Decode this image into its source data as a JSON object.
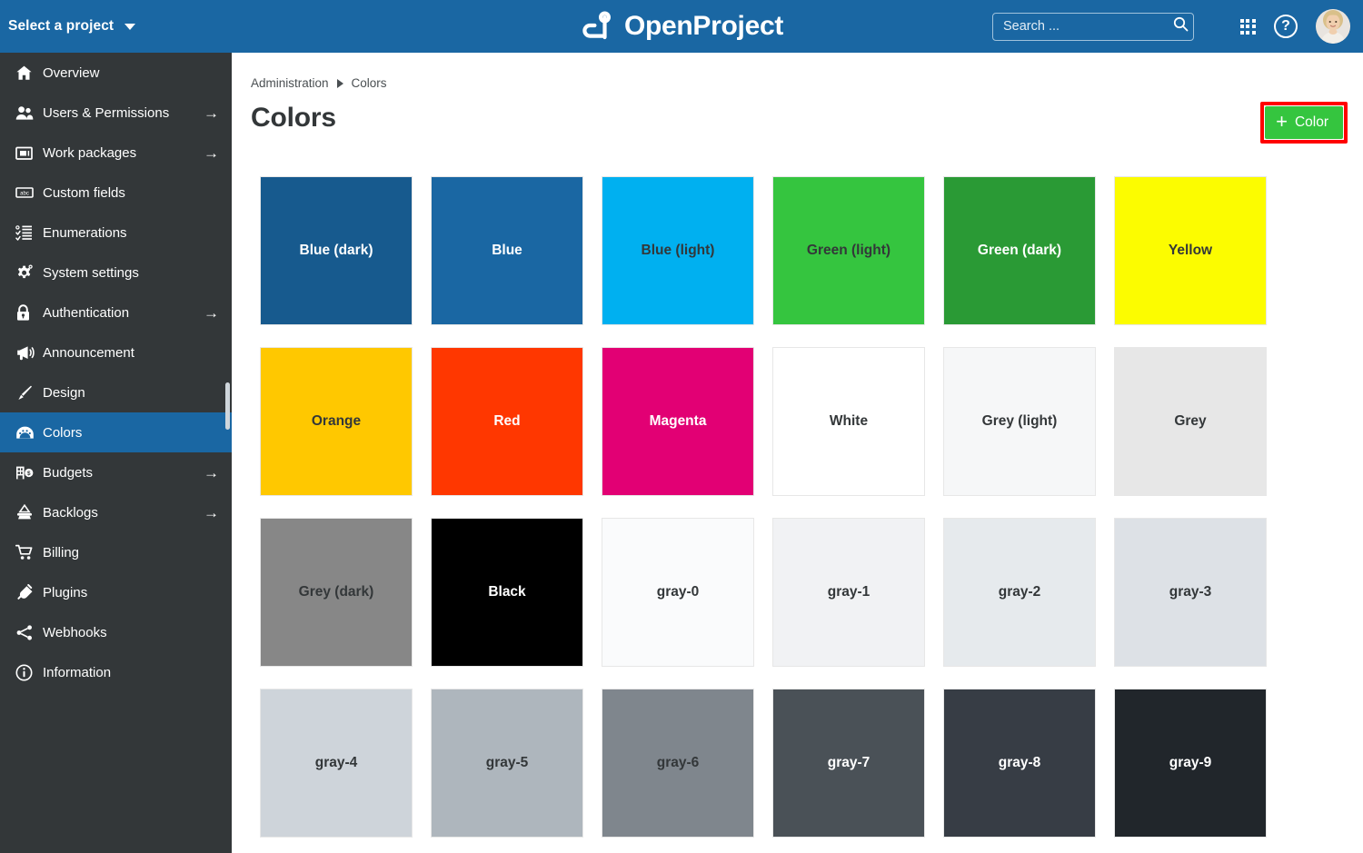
{
  "header": {
    "project_select_label": "Select a project",
    "logo_text": "OpenProject",
    "search_placeholder": "Search ...",
    "search_value": "",
    "brand_blue": "#1a67a3"
  },
  "sidebar": {
    "background": "#333739",
    "active_background": "#1a67a3",
    "items": [
      {
        "label": "Overview",
        "icon": "home-icon",
        "arrow": "",
        "active": false
      },
      {
        "label": "Users & Permissions",
        "icon": "users-icon",
        "arrow": "→",
        "active": false
      },
      {
        "label": "Work packages",
        "icon": "work-package-icon",
        "arrow": "→",
        "active": false
      },
      {
        "label": "Custom fields",
        "icon": "custom-field-icon",
        "arrow": "",
        "active": false
      },
      {
        "label": "Enumerations",
        "icon": "list-icon",
        "arrow": "",
        "active": false
      },
      {
        "label": "System settings",
        "icon": "gear-icon",
        "arrow": "",
        "active": false
      },
      {
        "label": "Authentication",
        "icon": "lock-icon",
        "arrow": "→",
        "active": false
      },
      {
        "label": "Announcement",
        "icon": "megaphone-icon",
        "arrow": "",
        "active": false
      },
      {
        "label": "Design",
        "icon": "brush-icon",
        "arrow": "",
        "active": false
      },
      {
        "label": "Colors",
        "icon": "palette-icon",
        "arrow": "",
        "active": true
      },
      {
        "label": "Budgets",
        "icon": "budget-icon",
        "arrow": "→",
        "active": false
      },
      {
        "label": "Backlogs",
        "icon": "backlogs-icon",
        "arrow": "→",
        "active": false
      },
      {
        "label": "Billing",
        "icon": "cart-icon",
        "arrow": "",
        "active": false
      },
      {
        "label": "Plugins",
        "icon": "plug-icon",
        "arrow": "",
        "active": false
      },
      {
        "label": "Webhooks",
        "icon": "webhook-icon",
        "arrow": "",
        "active": false
      },
      {
        "label": "Information",
        "icon": "info-icon",
        "arrow": "",
        "active": false
      }
    ]
  },
  "breadcrumb": {
    "parent": "Administration",
    "current": "Colors"
  },
  "page": {
    "title": "Colors"
  },
  "toolbar": {
    "add_color_label": "Color",
    "add_color_plus": "+",
    "add_color_background": "#35c53f",
    "highlight_color": "#ff0000"
  },
  "colors": [
    {
      "name": "Blue (dark)",
      "hex": "#175a8e",
      "text": "#ffffff"
    },
    {
      "name": "Blue",
      "hex": "#1a67a3",
      "text": "#ffffff"
    },
    {
      "name": "Blue (light)",
      "hex": "#00b0f0",
      "text": "#333739"
    },
    {
      "name": "Green (light)",
      "hex": "#35c53f",
      "text": "#333739"
    },
    {
      "name": "Green (dark)",
      "hex": "#2a9a35",
      "text": "#ffffff"
    },
    {
      "name": "Yellow",
      "hex": "#fcfc00",
      "text": "#333739"
    },
    {
      "name": "Orange",
      "hex": "#ffc800",
      "text": "#333739"
    },
    {
      "name": "Red",
      "hex": "#ff3700",
      "text": "#ffffff"
    },
    {
      "name": "Magenta",
      "hex": "#e20074",
      "text": "#ffffff"
    },
    {
      "name": "White",
      "hex": "#ffffff",
      "text": "#333739"
    },
    {
      "name": "Grey (light)",
      "hex": "#f6f7f8",
      "text": "#333739"
    },
    {
      "name": "Grey",
      "hex": "#e7e7e7",
      "text": "#333739"
    },
    {
      "name": "Grey (dark)",
      "hex": "#878787",
      "text": "#333739"
    },
    {
      "name": "Black",
      "hex": "#000000",
      "text": "#ffffff"
    },
    {
      "name": "gray-0",
      "hex": "#fafbfc",
      "text": "#333739"
    },
    {
      "name": "gray-1",
      "hex": "#f1f2f4",
      "text": "#333739"
    },
    {
      "name": "gray-2",
      "hex": "#e6eaed",
      "text": "#333739"
    },
    {
      "name": "gray-3",
      "hex": "#dde1e6",
      "text": "#333739"
    },
    {
      "name": "gray-4",
      "hex": "#ced4da",
      "text": "#333739"
    },
    {
      "name": "gray-5",
      "hex": "#aeb6bd",
      "text": "#333739"
    },
    {
      "name": "gray-6",
      "hex": "#7f868d",
      "text": "#333739"
    },
    {
      "name": "gray-7",
      "hex": "#4a5157",
      "text": "#ffffff"
    },
    {
      "name": "gray-8",
      "hex": "#373d45",
      "text": "#ffffff"
    },
    {
      "name": "gray-9",
      "hex": "#21262b",
      "text": "#ffffff"
    }
  ]
}
